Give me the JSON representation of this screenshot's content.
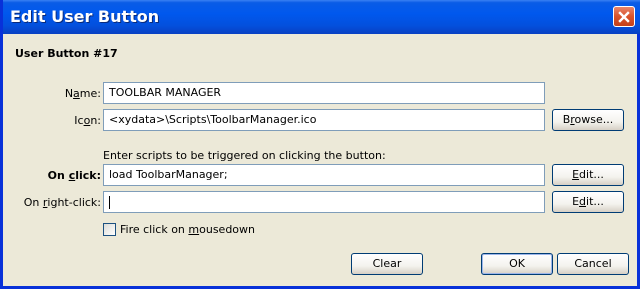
{
  "window": {
    "title": "Edit User Button",
    "close_icon": "close-icon"
  },
  "heading": "User Button #17",
  "name_field": {
    "label": "Name:",
    "value": "TOOLBAR MANAGER"
  },
  "icon_field": {
    "label": "Icon:",
    "value": "<xydata>\\Scripts\\ToolbarManager.ico",
    "browse_label": "Browse..."
  },
  "scripts_note": "Enter scripts to be triggered on clicking the button:",
  "onclick_field": {
    "label": "On click:",
    "value": "load ToolbarManager;",
    "edit_label": "Edit..."
  },
  "onrightclick_field": {
    "label": "On right-click:",
    "value": "",
    "edit_label": "Edit..."
  },
  "fire_on_mousedown": {
    "label": "Fire click on mousedown",
    "checked": false
  },
  "buttons": {
    "clear": "Clear",
    "ok": "OK",
    "cancel": "Cancel"
  },
  "colors": {
    "titlebar": "#0058ee",
    "frame": "#0831d9",
    "dialog_bg": "#ece9d8",
    "close": "#d9532b"
  }
}
